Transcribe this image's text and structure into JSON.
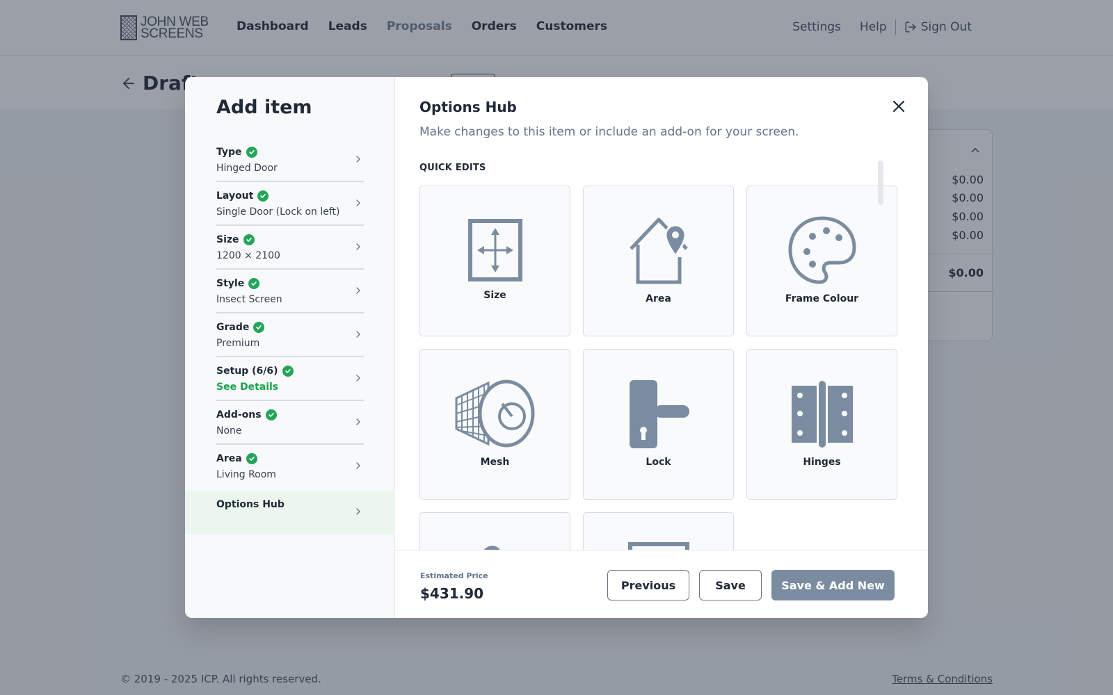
{
  "brand": {
    "line1": "JOHN WEB",
    "line2": "SCREENS"
  },
  "nav": {
    "links": [
      {
        "label": "Dashboard"
      },
      {
        "label": "Leads"
      },
      {
        "label": "Proposals"
      },
      {
        "label": "Orders"
      },
      {
        "label": "Customers"
      }
    ],
    "active": "Proposals",
    "settings": "Settings",
    "help": "Help",
    "signout": "Sign Out"
  },
  "page": {
    "title": "Draft"
  },
  "summary": {
    "rows": [
      "$0.00",
      "$0.00",
      "$0.00",
      "$0.00"
    ],
    "total": "$0.00"
  },
  "footer": {
    "copyright": "© 2019 - 2025 ICP. All rights reserved.",
    "terms": "Terms & Conditions"
  },
  "modal": {
    "title": "Add item",
    "steps": [
      {
        "label": "Type",
        "value": "Hinged Door"
      },
      {
        "label": "Layout",
        "value": "Single Door (Lock on left)"
      },
      {
        "label": "Size",
        "value": "1200 × 2100"
      },
      {
        "label": "Style",
        "value": "Insect Screen"
      },
      {
        "label": "Grade",
        "value": "Premium"
      },
      {
        "label": "Setup (6/6)",
        "value": "See Details"
      },
      {
        "label": "Add-ons",
        "value": "None"
      },
      {
        "label": "Area",
        "value": "Living Room"
      }
    ],
    "active_step": "Options Hub",
    "hub": {
      "title": "Options Hub",
      "subtitle": "Make changes to this item or include an add-on for your screen.",
      "section": "QUICK EDITS",
      "tiles": [
        {
          "label": "Size",
          "icon": "resize-arrows-icon"
        },
        {
          "label": "Area",
          "icon": "house-pin-icon"
        },
        {
          "label": "Frame Colour",
          "icon": "palette-icon"
        },
        {
          "label": "Mesh",
          "icon": "mesh-roll-icon"
        },
        {
          "label": "Lock",
          "icon": "door-handle-lock-icon"
        },
        {
          "label": "Hinges",
          "icon": "hinge-icon"
        }
      ]
    },
    "estimated_price_label": "Estimated Price",
    "estimated_price": "$431.90",
    "buttons": {
      "previous": "Previous",
      "save": "Save",
      "save_add_new": "Save & Add New"
    },
    "colors": {
      "accent": "#7b8ca0",
      "success": "#22a55a",
      "icon": "#7b8ca0"
    }
  }
}
